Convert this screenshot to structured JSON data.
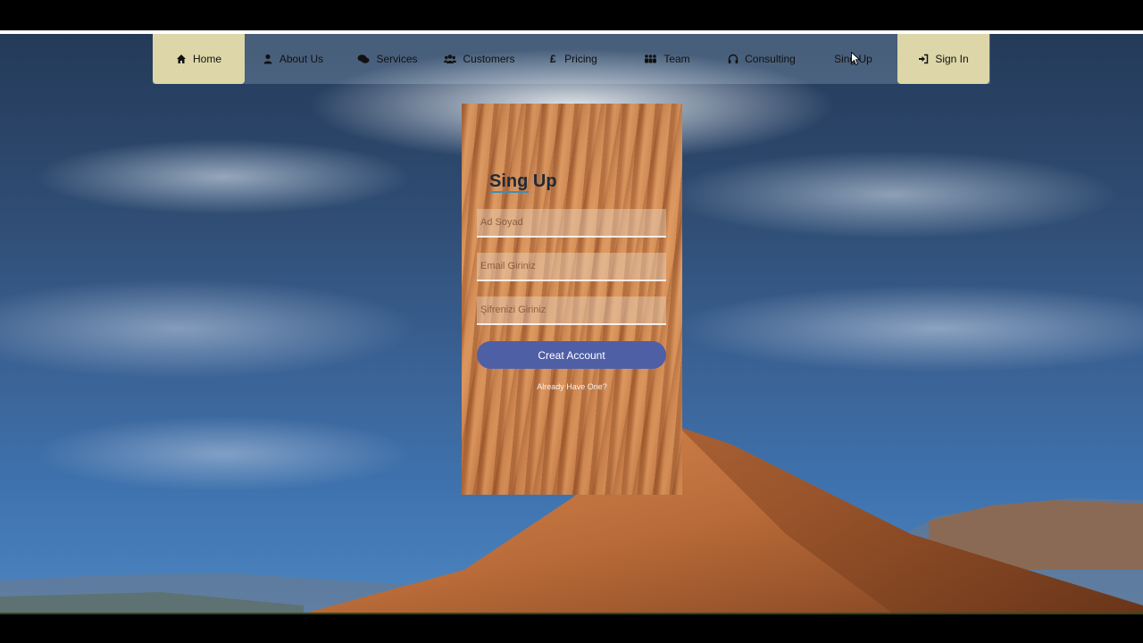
{
  "nav": {
    "items": [
      {
        "label": "Home",
        "icon": "home-icon",
        "active": true
      },
      {
        "label": "About Us",
        "icon": "user-icon",
        "active": false
      },
      {
        "label": "Services",
        "icon": "comments-icon",
        "active": false
      },
      {
        "label": "Customers",
        "icon": "users-icon",
        "active": false
      },
      {
        "label": "Pricing",
        "icon": "pound-icon",
        "active": false
      },
      {
        "label": "Team",
        "icon": "team-icon",
        "active": false
      },
      {
        "label": "Consulting",
        "icon": "headphones-icon",
        "active": false
      },
      {
        "label": "Sing Up",
        "icon": "",
        "active": false
      },
      {
        "label": "Sign In",
        "icon": "sign-in-icon",
        "active": true
      }
    ]
  },
  "form": {
    "title": "Sing Up",
    "name_placeholder": "Ad Soyad",
    "email_placeholder": "Email Giriniz",
    "password_placeholder": "Şifrenizi Giriniz",
    "submit_label": "Creat Account",
    "already_label": "Already Have One?"
  },
  "colors": {
    "nav_active": "#ddd6a8",
    "button": "#4f5fa6",
    "title_underline": "#3d8fb5"
  }
}
